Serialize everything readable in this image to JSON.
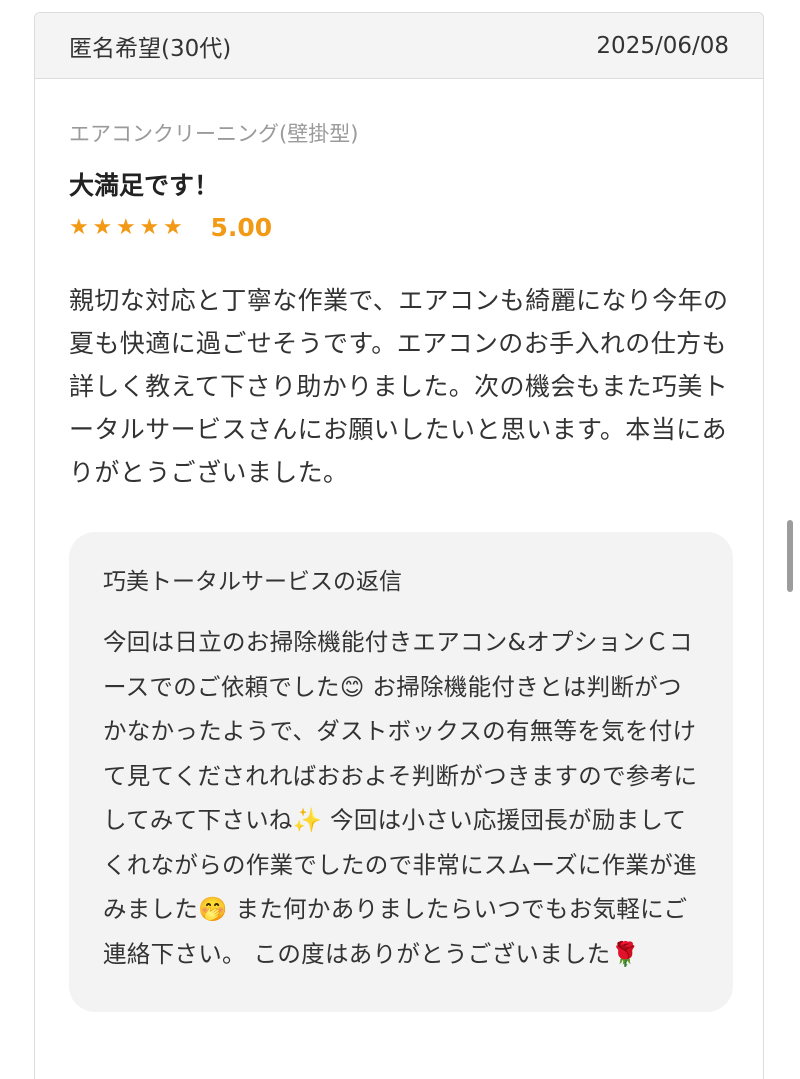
{
  "review": {
    "reviewer": "匿名希望(30代)",
    "date": "2025/06/08",
    "service": "エアコンクリーニング(壁掛型)",
    "title": "大満足です！",
    "rating": {
      "stars": 5,
      "max_stars": 5,
      "score": "5.00",
      "star_color": "#f29a16"
    },
    "body": "親切な対応と丁寧な作業で、エアコンも綺麗になり今年の夏も快適に過ごせそうです。エアコンのお手入れの仕方も詳しく教えて下さり助かりました。次の機会もまた巧美トータルサービスさんにお願いしたいと思います。本当にありがとうございました。"
  },
  "reply": {
    "title": "巧美トータルサービスの返信",
    "body": "今回は日立のお掃除機能付きエアコン&オプションＣコースでのご依頼でした😊 お掃除機能付きとは判断がつかなかったようで、ダストボックスの有無等を気を付けて見てくだされればおおよそ判断がつきますので参考にしてみて下さいね✨ 今回は小さい応援団長が励ましてくれながらの作業でしたので非常にスムーズに作業が進みました🤭 また何かありましたらいつでもお気軽にご連絡下さい。 この度はありがとうございました🌹"
  }
}
